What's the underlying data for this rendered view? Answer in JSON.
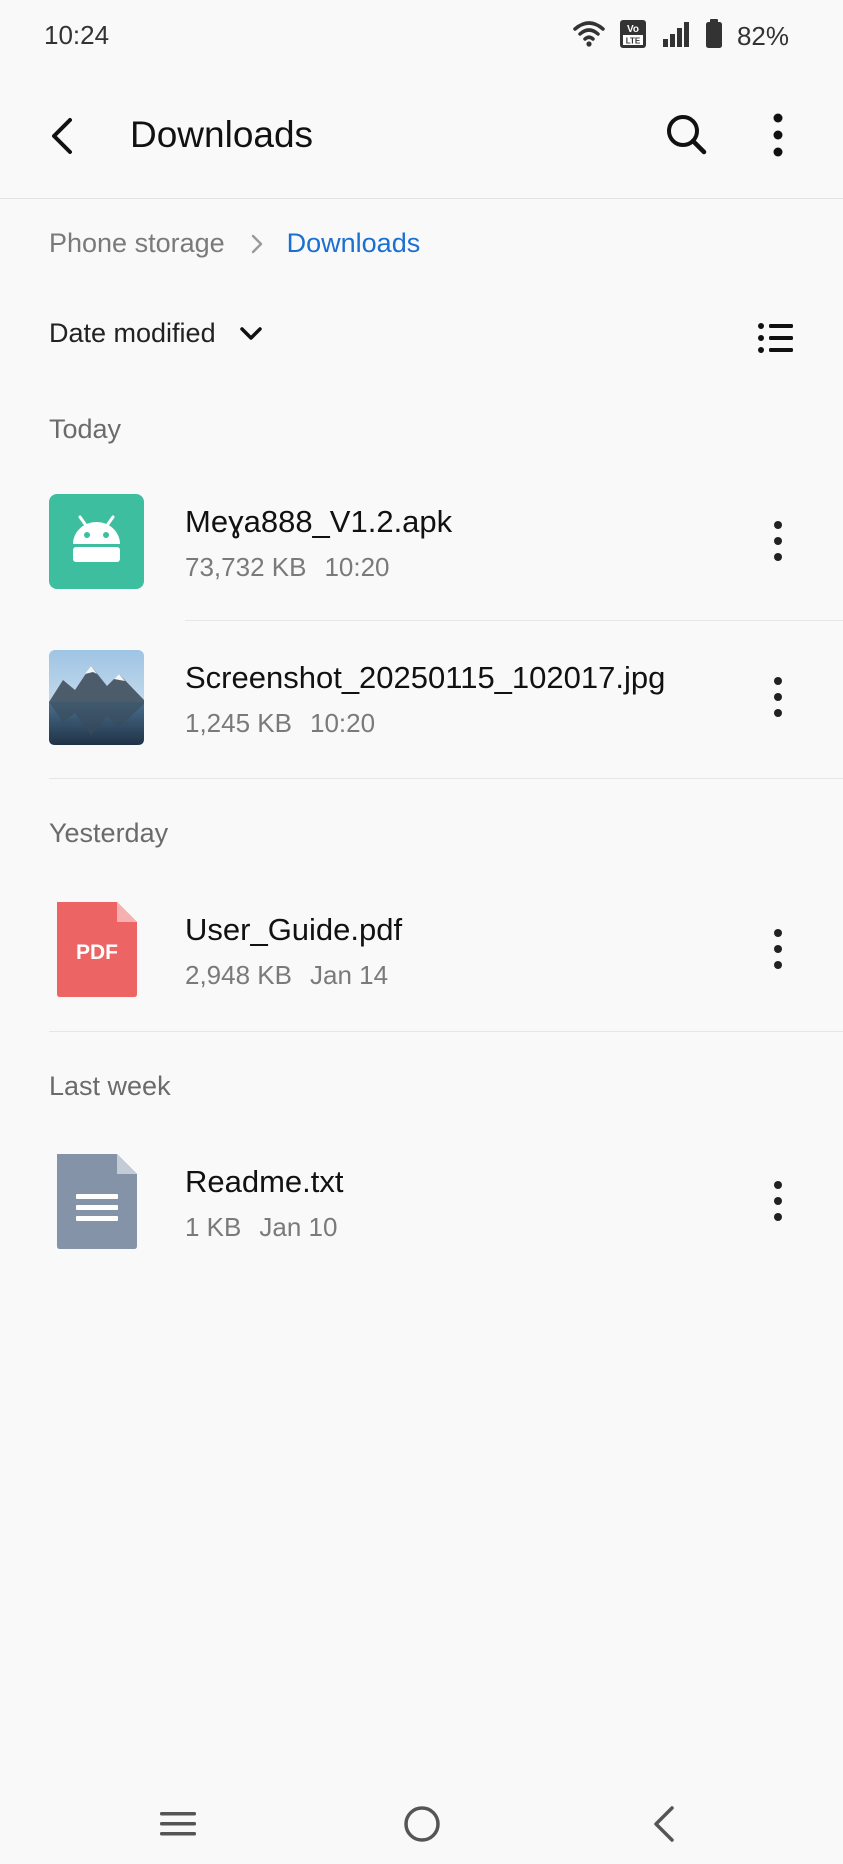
{
  "status_bar": {
    "time": "10:24",
    "battery_percent": "82%",
    "icons": [
      "wifi-icon",
      "volte-icon",
      "signal-icon",
      "battery-icon"
    ]
  },
  "app_bar": {
    "title": "Downloads",
    "icons": [
      "back-arrow-icon",
      "search-icon",
      "more-vertical-icon"
    ]
  },
  "breadcrumb": {
    "root": "Phone storage",
    "current": "Downloads"
  },
  "sort": {
    "label": "Date modified"
  },
  "sections": [
    {
      "header": "Today",
      "files": [
        {
          "name": "Meɣa888_V1.2.apk",
          "size": "73,732 KB",
          "date": "10:20",
          "type": "apk"
        },
        {
          "name": "Screenshot_20250115_102017.jpg",
          "size": "1,245 KB",
          "date": "10:20",
          "type": "image"
        }
      ]
    },
    {
      "header": "Yesterday",
      "files": [
        {
          "name": "User_Guide.pdf",
          "size": "2,948 KB",
          "date": "Jan 14",
          "type": "pdf",
          "icon_label": "PDF"
        }
      ]
    },
    {
      "header": "Last week",
      "files": [
        {
          "name": "Readme.txt",
          "size": "1 KB",
          "date": "Jan 10",
          "type": "txt"
        }
      ]
    }
  ],
  "colors": {
    "accent": "#1a6fd3",
    "apk_icon": "#3dbf9f",
    "pdf_icon": "#ec6464",
    "txt_icon": "#8593a8",
    "background": "#f9f9f9"
  },
  "nav_bar": {
    "icons": [
      "recents-icon",
      "home-icon",
      "back-icon"
    ]
  }
}
